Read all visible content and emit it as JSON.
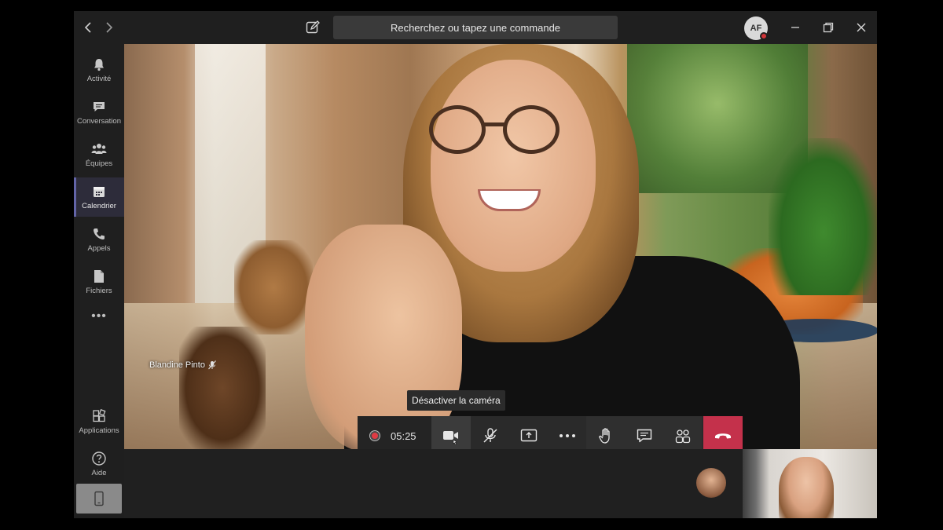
{
  "titlebar": {
    "search_placeholder": "Recherchez ou tapez une commande",
    "avatar_initials": "AF"
  },
  "rail": {
    "items": [
      {
        "label": "Activité",
        "icon": "bell-icon"
      },
      {
        "label": "Conversation",
        "icon": "chat-icon"
      },
      {
        "label": "Équipes",
        "icon": "teams-icon"
      },
      {
        "label": "Calendrier",
        "icon": "calendar-icon",
        "active": true
      },
      {
        "label": "Appels",
        "icon": "phone-icon"
      },
      {
        "label": "Fichiers",
        "icon": "file-icon"
      }
    ],
    "more": "•••",
    "apps_label": "Applications",
    "help_label": "Aide"
  },
  "call": {
    "participant_name": "Blandine Pinto",
    "timer": "05:25",
    "tooltip": "Désactiver la caméra"
  },
  "colors": {
    "accent": "#6264a7",
    "hangup": "#c4314b",
    "record": "#e03b44"
  }
}
